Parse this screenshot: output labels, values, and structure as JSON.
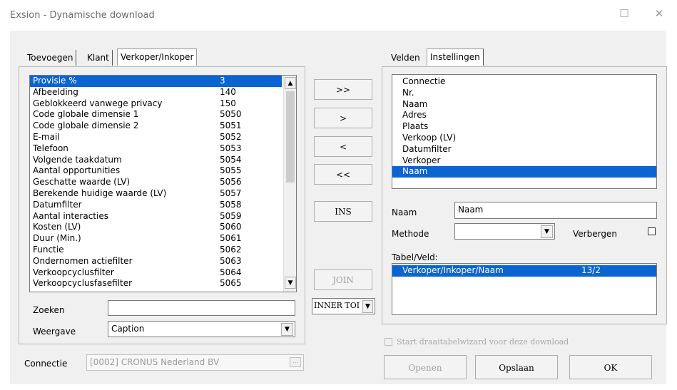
{
  "window": {
    "title": "Exsion - Dynamische download",
    "maximize_glyph": "☐",
    "close_glyph": "✕"
  },
  "left_tabs": [
    "Toevoegen",
    "Klant",
    "Verkoper/Inkoper"
  ],
  "field_list": [
    {
      "name": "Provisie %",
      "code": "3"
    },
    {
      "name": "Afbeelding",
      "code": "140"
    },
    {
      "name": "Geblokkeerd vanwege privacy",
      "code": "150"
    },
    {
      "name": "Code globale dimensie 1",
      "code": "5050"
    },
    {
      "name": "Code globale dimensie 2",
      "code": "5051"
    },
    {
      "name": "E-mail",
      "code": "5052"
    },
    {
      "name": "Telefoon",
      "code": "5053"
    },
    {
      "name": "Volgende taakdatum",
      "code": "5054"
    },
    {
      "name": "Aantal opportunities",
      "code": "5055"
    },
    {
      "name": "Geschatte waarde (LV)",
      "code": "5056"
    },
    {
      "name": "Berekende huidige waarde (LV)",
      "code": "5057"
    },
    {
      "name": "Datumfilter",
      "code": "5058"
    },
    {
      "name": "Aantal interacties",
      "code": "5059"
    },
    {
      "name": "Kosten (LV)",
      "code": "5060"
    },
    {
      "name": "Duur (Min.)",
      "code": "5061"
    },
    {
      "name": "Functie",
      "code": "5062"
    },
    {
      "name": "Ondernomen actiefilter",
      "code": "5063"
    },
    {
      "name": "Verkoopcyclusfilter",
      "code": "5064"
    },
    {
      "name": "Verkoopcyclusfasefilter",
      "code": "5065"
    }
  ],
  "search": {
    "label": "Zoeken",
    "value": ""
  },
  "display": {
    "label": "Weergave",
    "value": "Caption"
  },
  "connection": {
    "label": "Connectie",
    "value": "[0002] CRONUS Nederland BV",
    "browse": "..."
  },
  "move_buttons": {
    "add_all": ">>",
    "add": ">",
    "remove": "<",
    "remove_all": "<<",
    "ins": "INS",
    "join": "JOIN",
    "join_type": "INNER TOI"
  },
  "right_tabs": [
    "Velden",
    "Instellingen"
  ],
  "selected_fields": [
    "Connectie",
    "Nr.",
    "Naam",
    "Adres",
    "Plaats",
    "Verkoop (LV)",
    "Datumfilter",
    "Verkoper",
    "Naam"
  ],
  "selected_field_index": 8,
  "props": {
    "name_label": "Naam",
    "name_value": "Naam",
    "method_label": "Methode",
    "method_value": "",
    "hide_label": "Verbergen",
    "table_field_label": "Tabel/Veld:",
    "table_field_rows": [
      {
        "path": "Verkoper/Inkoper/Naam",
        "code": "13/2"
      }
    ]
  },
  "pivot_checkbox": "Start draaitabelwizard voor deze download",
  "bottom_buttons": {
    "open": "Openen",
    "save": "Opslaan",
    "ok": "OK"
  },
  "icons": {
    "scroll_up": "▲",
    "scroll_down": "▼",
    "dropdown": "▼"
  }
}
